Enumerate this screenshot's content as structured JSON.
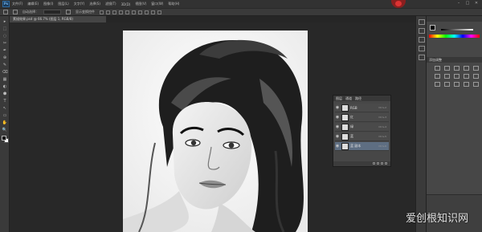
{
  "app": {
    "logo": "Ps",
    "menus": [
      "文件(F)",
      "编辑(E)",
      "图像(I)",
      "图层(L)",
      "文字(Y)",
      "选择(S)",
      "滤镜(T)",
      "3D(D)",
      "视图(V)",
      "窗口(W)",
      "帮助(H)"
    ],
    "window_controls": [
      "–",
      "□",
      "✕"
    ]
  },
  "options": {
    "label_auto_select": "自动选择：",
    "label_transform": "显示变换控件"
  },
  "document": {
    "tab_title": "素描效果.psd @ 66.7% (图层 1, RGB/8)"
  },
  "toolbar": {
    "tools": [
      "▸",
      "⬚",
      "◌",
      "✂",
      "✒",
      "⊕",
      "✎",
      "⌫",
      "▦",
      "◐",
      "⬢",
      "T",
      "↖",
      "▭",
      "✋",
      "🔍"
    ]
  },
  "layers_panel": {
    "tabs": [
      "图层",
      "通道",
      "路径"
    ],
    "rows": [
      {
        "name": "RGB",
        "shortcut": "Ctrl+2",
        "selected": false
      },
      {
        "name": "红",
        "shortcut": "Ctrl+3",
        "selected": false
      },
      {
        "name": "绿",
        "shortcut": "Ctrl+4",
        "selected": false
      },
      {
        "name": "蓝",
        "shortcut": "Ctrl+5",
        "selected": false
      },
      {
        "name": "蓝 副本",
        "shortcut": "Ctrl+6",
        "selected": true
      }
    ]
  },
  "right_panel": {
    "adjustments_title": "添加调整"
  },
  "watermark": "爱创根知识网"
}
